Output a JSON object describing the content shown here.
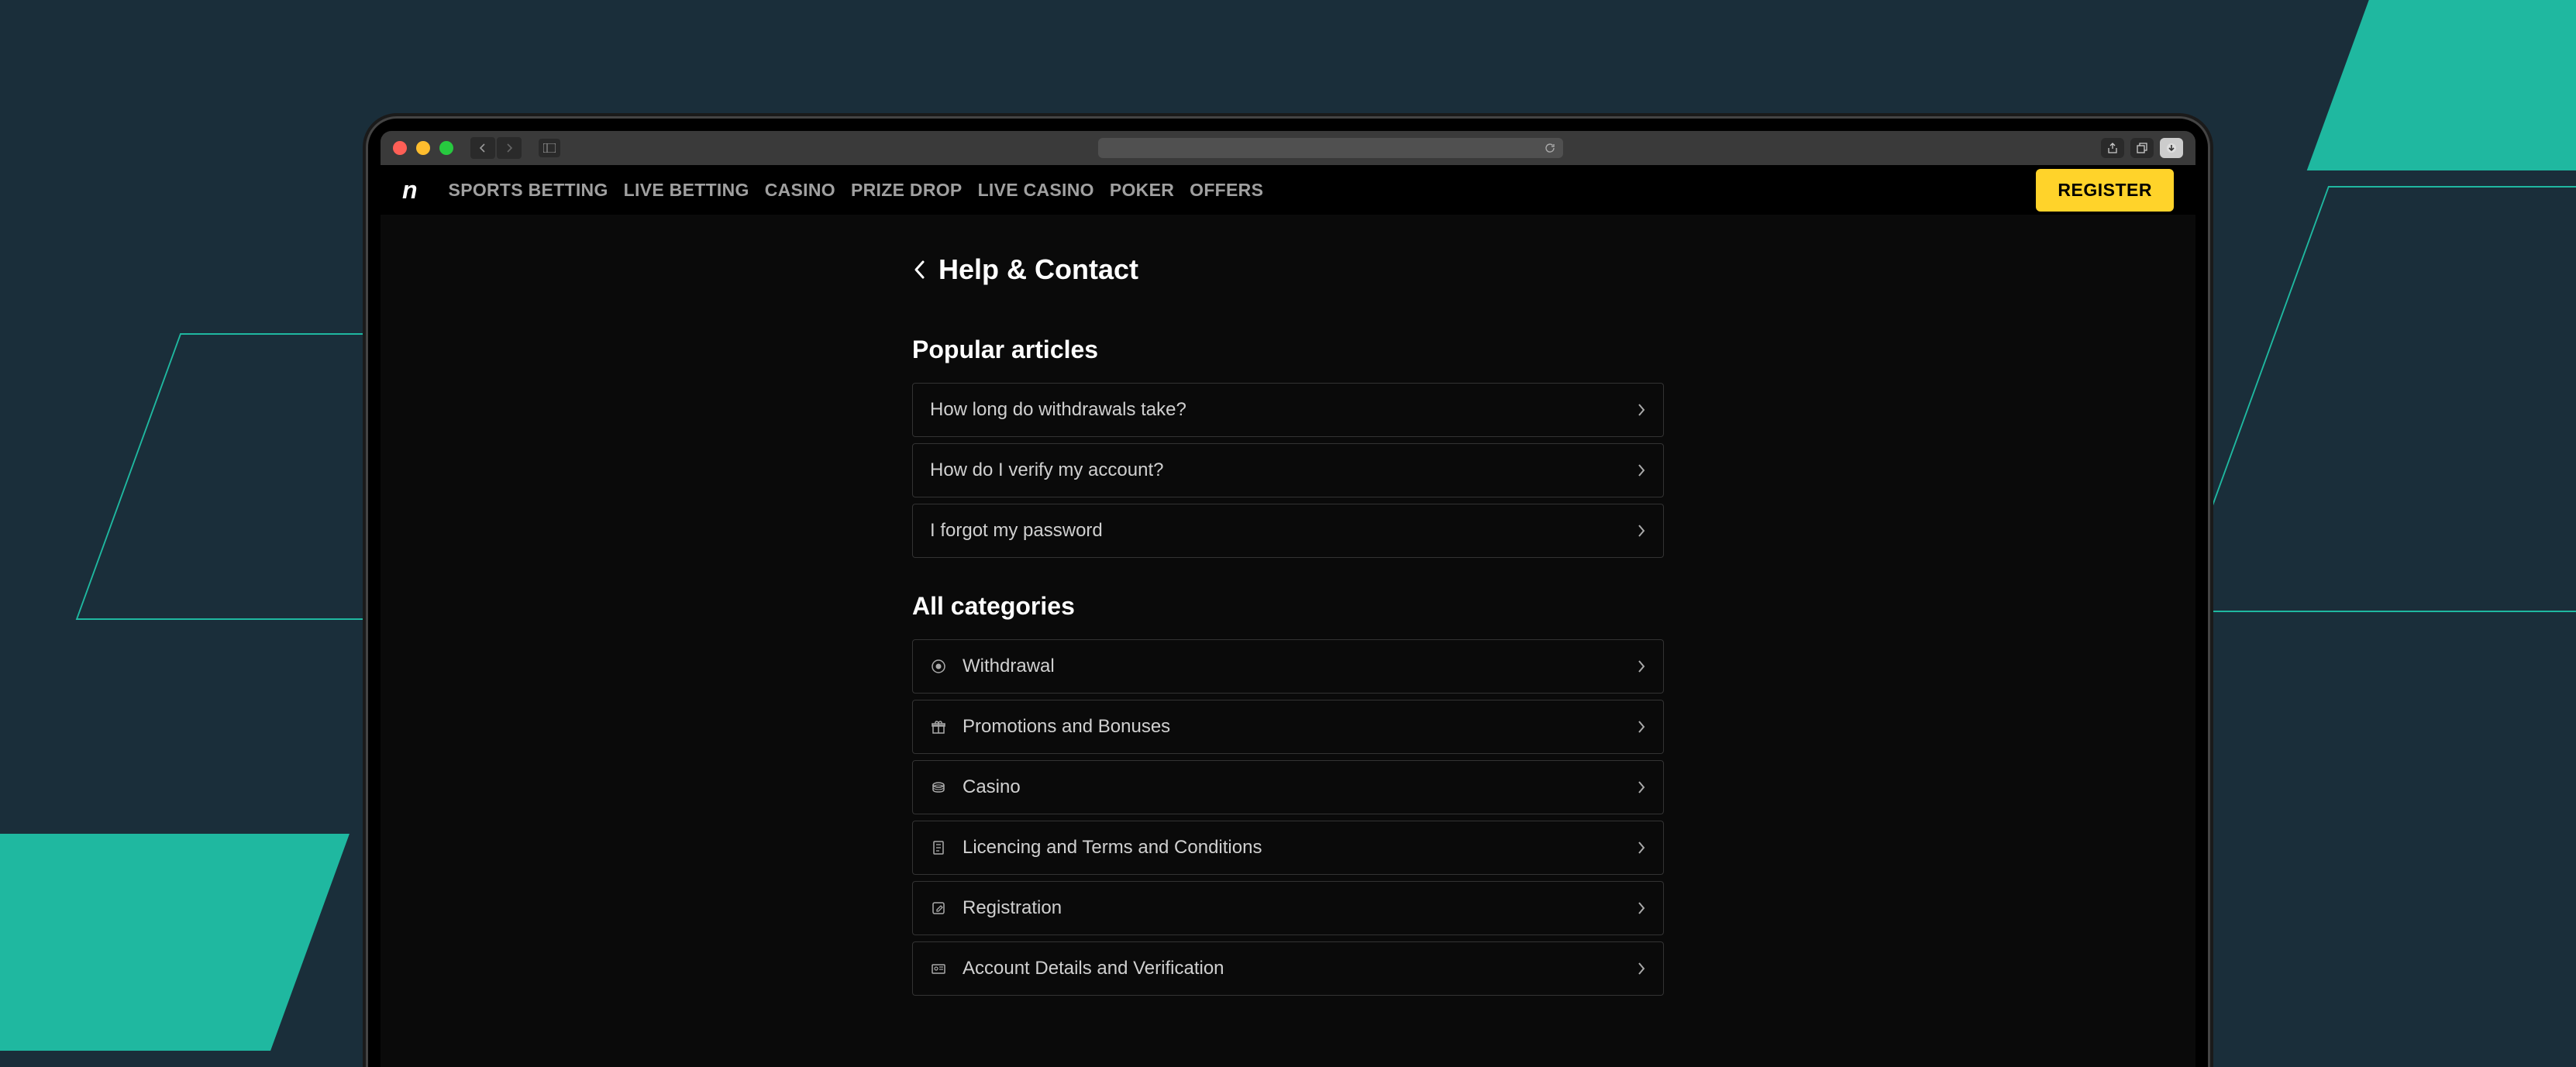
{
  "nav": {
    "items": [
      "SPORTS BETTING",
      "LIVE BETTING",
      "CASINO",
      "PRIZE DROP",
      "LIVE CASINO",
      "POKER",
      "OFFERS"
    ],
    "register": "REGISTER",
    "logo": "n"
  },
  "page": {
    "title": "Help & Contact"
  },
  "popular": {
    "heading": "Popular articles",
    "items": [
      "How long do withdrawals take?",
      "How do I verify my account?",
      "I forgot my password"
    ]
  },
  "categories": {
    "heading": "All categories",
    "items": [
      {
        "icon": "withdrawal",
        "label": "Withdrawal"
      },
      {
        "icon": "gift",
        "label": "Promotions and Bonuses"
      },
      {
        "icon": "casino",
        "label": "Casino"
      },
      {
        "icon": "document",
        "label": "Licencing and Terms and Conditions"
      },
      {
        "icon": "edit",
        "label": "Registration"
      },
      {
        "icon": "id",
        "label": "Account Details and Verification"
      }
    ]
  }
}
